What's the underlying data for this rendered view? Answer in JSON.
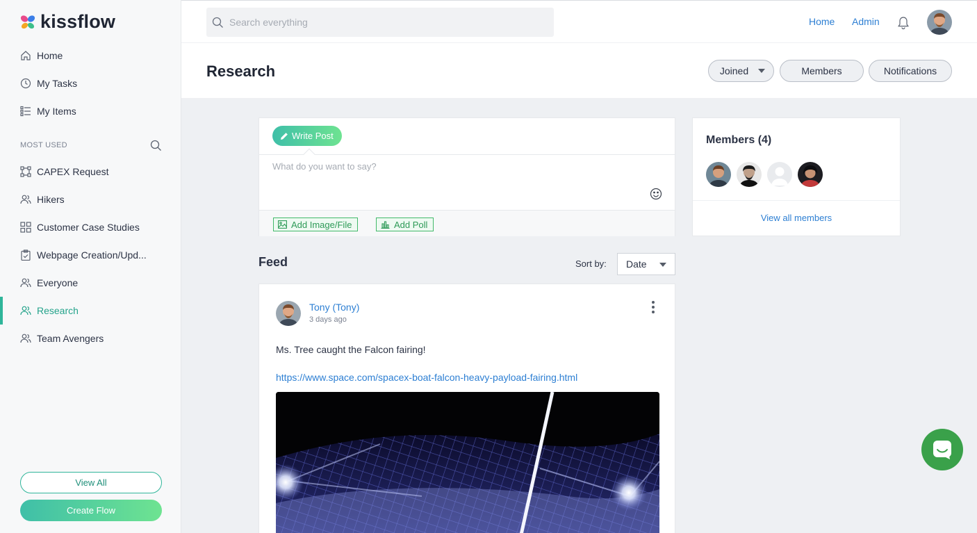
{
  "app": {
    "brand": "kissflow",
    "colors": {
      "accent": "#2fb59a",
      "link": "#2d7fd3",
      "chat": "#3aa14a"
    }
  },
  "sidebar": {
    "primary": [
      {
        "label": "Home",
        "icon": "home-icon"
      },
      {
        "label": "My Tasks",
        "icon": "clock-icon"
      },
      {
        "label": "My Items",
        "icon": "list-icon"
      }
    ],
    "section_label": "MOST USED",
    "most_used": [
      {
        "label": "CAPEX Request",
        "icon": "flow-icon"
      },
      {
        "label": "Hikers",
        "icon": "people-icon"
      },
      {
        "label": "Customer Case Studies",
        "icon": "grid-icon"
      },
      {
        "label": "Webpage Creation/Upd...",
        "icon": "clipboard-icon"
      },
      {
        "label": "Everyone",
        "icon": "people-icon"
      },
      {
        "label": "Research",
        "icon": "people-icon",
        "active": true
      },
      {
        "label": "Team Avengers",
        "icon": "people-icon"
      }
    ],
    "view_all_label": "View All",
    "create_flow_label": "Create Flow"
  },
  "topbar": {
    "search_placeholder": "Search everything",
    "links": [
      "Home",
      "Admin"
    ]
  },
  "page": {
    "title": "Research",
    "actions": {
      "joined": "Joined",
      "members": "Members",
      "notifications": "Notifications"
    }
  },
  "composer": {
    "write_post_label": "Write Post",
    "placeholder": "What do you want to say?",
    "add_image_label": "Add Image/File",
    "add_poll_label": "Add Poll"
  },
  "feed": {
    "title": "Feed",
    "sort_label": "Sort by:",
    "sort_value": "Date",
    "post": {
      "author": "Tony (Tony)",
      "time": "3 days ago",
      "text": "Ms. Tree caught the Falcon fairing!",
      "link": "https://www.space.com/spacex-boat-falcon-heavy-payload-fairing.html"
    }
  },
  "members": {
    "title": "Members (4)",
    "count": 4,
    "view_all_label": "View all members"
  }
}
